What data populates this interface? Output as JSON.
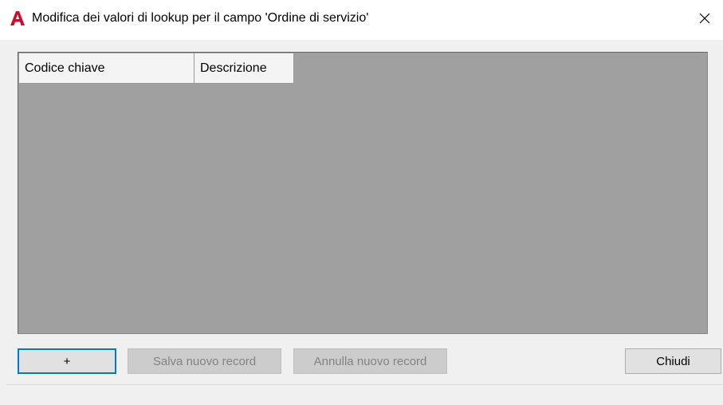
{
  "window": {
    "title": "Modifica dei valori di lookup per il campo 'Ordine di servizio'",
    "icon": "autocad-a-icon",
    "accent_color": "#c0392b"
  },
  "grid": {
    "columns": [
      "Codice chiave",
      "Descrizione"
    ],
    "rows": [],
    "background_color": "#a0a0a0"
  },
  "buttons": {
    "add_label": "+",
    "save_label": "Salva nuovo record",
    "cancel_label": "Annulla nuovo record",
    "close_label": "Chiudi"
  },
  "states": {
    "save_enabled": false,
    "cancel_enabled": false,
    "add_focused": true
  }
}
